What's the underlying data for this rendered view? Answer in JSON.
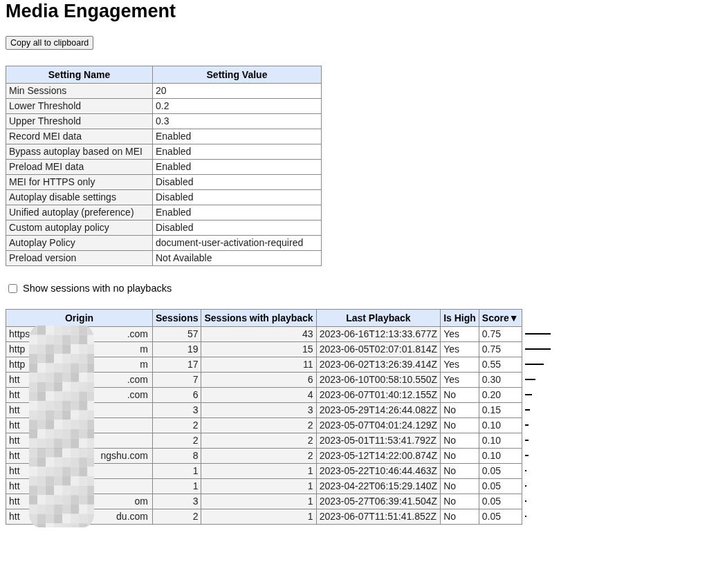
{
  "title": "Media Engagement",
  "copy_button": "Copy all to clipboard",
  "settings": {
    "columns": [
      "Setting Name",
      "Setting Value"
    ],
    "rows": [
      [
        "Min Sessions",
        "20"
      ],
      [
        "Lower Threshold",
        "0.2"
      ],
      [
        "Upper Threshold",
        "0.3"
      ],
      [
        "Record MEI data",
        "Enabled"
      ],
      [
        "Bypass autoplay based on MEI",
        "Enabled"
      ],
      [
        "Preload MEI data",
        "Enabled"
      ],
      [
        "MEI for HTTPS only",
        "Disabled"
      ],
      [
        "Autoplay disable settings",
        "Disabled"
      ],
      [
        "Unified autoplay (preference)",
        "Enabled"
      ],
      [
        "Custom autoplay policy",
        "Disabled"
      ],
      [
        "Autoplay Policy",
        "document-user-activation-required"
      ],
      [
        "Preload version",
        "Not Available"
      ]
    ]
  },
  "show_no_playbacks": {
    "label": "Show sessions with no playbacks",
    "checked": false
  },
  "sessions": {
    "columns": [
      "Origin",
      "Sessions",
      "Sessions with playback",
      "Last Playback",
      "Is High",
      "Score▼"
    ],
    "rows": [
      {
        "origin_start": "https",
        "origin_end": ".com",
        "sessions": "57",
        "playback": "43",
        "last": "2023-06-16T12:13:33.677Z",
        "high": "Yes",
        "score": "0.75",
        "level": 0.75
      },
      {
        "origin_start": "http",
        "origin_end": "m",
        "sessions": "19",
        "playback": "15",
        "last": "2023-06-05T02:07:01.814Z",
        "high": "Yes",
        "score": "0.75",
        "level": 0.75
      },
      {
        "origin_start": "http",
        "origin_end": "m",
        "sessions": "17",
        "playback": "11",
        "last": "2023-06-02T13:26:39.414Z",
        "high": "Yes",
        "score": "0.55",
        "level": 0.55
      },
      {
        "origin_start": "htt",
        "origin_end": ".com",
        "sessions": "7",
        "playback": "6",
        "last": "2023-06-10T00:58:10.550Z",
        "high": "Yes",
        "score": "0.30",
        "level": 0.3
      },
      {
        "origin_start": "htt",
        "origin_end": ".com",
        "sessions": "6",
        "playback": "4",
        "last": "2023-06-07T01:40:12.155Z",
        "high": "No",
        "score": "0.20",
        "level": 0.2
      },
      {
        "origin_start": "htt",
        "sessions": "3",
        "playback": "3",
        "last": "2023-05-29T14:26:44.082Z",
        "high": "No",
        "score": "0.15",
        "level": 0.15
      },
      {
        "origin_start": "htt",
        "sessions": "2",
        "playback": "2",
        "last": "2023-05-07T04:01:24.129Z",
        "high": "No",
        "score": "0.10",
        "level": 0.1
      },
      {
        "origin_start": "htt",
        "sessions": "2",
        "playback": "2",
        "last": "2023-05-01T11:53:41.792Z",
        "high": "No",
        "score": "0.10",
        "level": 0.1
      },
      {
        "origin_start": "htt",
        "origin_end": "ngshu.com",
        "sessions": "8",
        "playback": "2",
        "last": "2023-05-12T14:22:00.874Z",
        "high": "No",
        "score": "0.10",
        "level": 0.1
      },
      {
        "origin_start": "htt",
        "sessions": "1",
        "playback": "1",
        "last": "2023-05-22T10:46:44.463Z",
        "high": "No",
        "score": "0.05",
        "level": 0.05
      },
      {
        "origin_start": "htt",
        "sessions": "1",
        "playback": "1",
        "last": "2023-04-22T06:15:29.140Z",
        "high": "No",
        "score": "0.05",
        "level": 0.05
      },
      {
        "origin_start": "htt",
        "origin_end": "om",
        "sessions": "3",
        "playback": "1",
        "last": "2023-05-27T06:39:41.504Z",
        "high": "No",
        "score": "0.05",
        "level": 0.05
      },
      {
        "origin_start": "htt",
        "origin_end": "du.com",
        "sessions": "2",
        "playback": "1",
        "last": "2023-06-07T11:51:41.852Z",
        "high": "No",
        "score": "0.05",
        "level": 0.05
      }
    ]
  }
}
